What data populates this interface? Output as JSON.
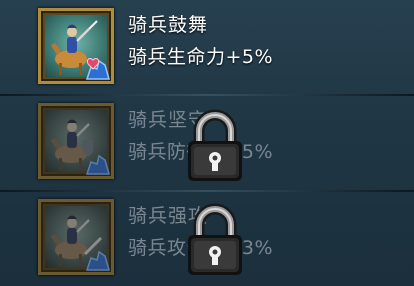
{
  "skills": [
    {
      "name": "骑兵鼓舞",
      "effect": "骑兵生命力+5%",
      "state": "unlocked",
      "icon": "cavalry-knight-icon",
      "badge_icon": "heart-cavalry-badge-icon"
    },
    {
      "name": "骑兵坚守",
      "effect": "骑兵防御力+5%",
      "state": "locked",
      "icon": "cavalry-knight-icon",
      "badge_icon": "shield-cavalry-badge-icon"
    },
    {
      "name": "骑兵强攻",
      "effect": "骑兵攻击力+3%",
      "state": "locked",
      "icon": "cavalry-knight-icon",
      "badge_icon": "sword-cavalry-badge-icon"
    }
  ],
  "colors": {
    "background": "#1e3443",
    "frame_gold": "#b08d3a",
    "unlocked_text": "#ffffff",
    "locked_text": "#7a8791",
    "badge_blue": "#2a6fd6",
    "badge_heart": "#e8456b"
  }
}
